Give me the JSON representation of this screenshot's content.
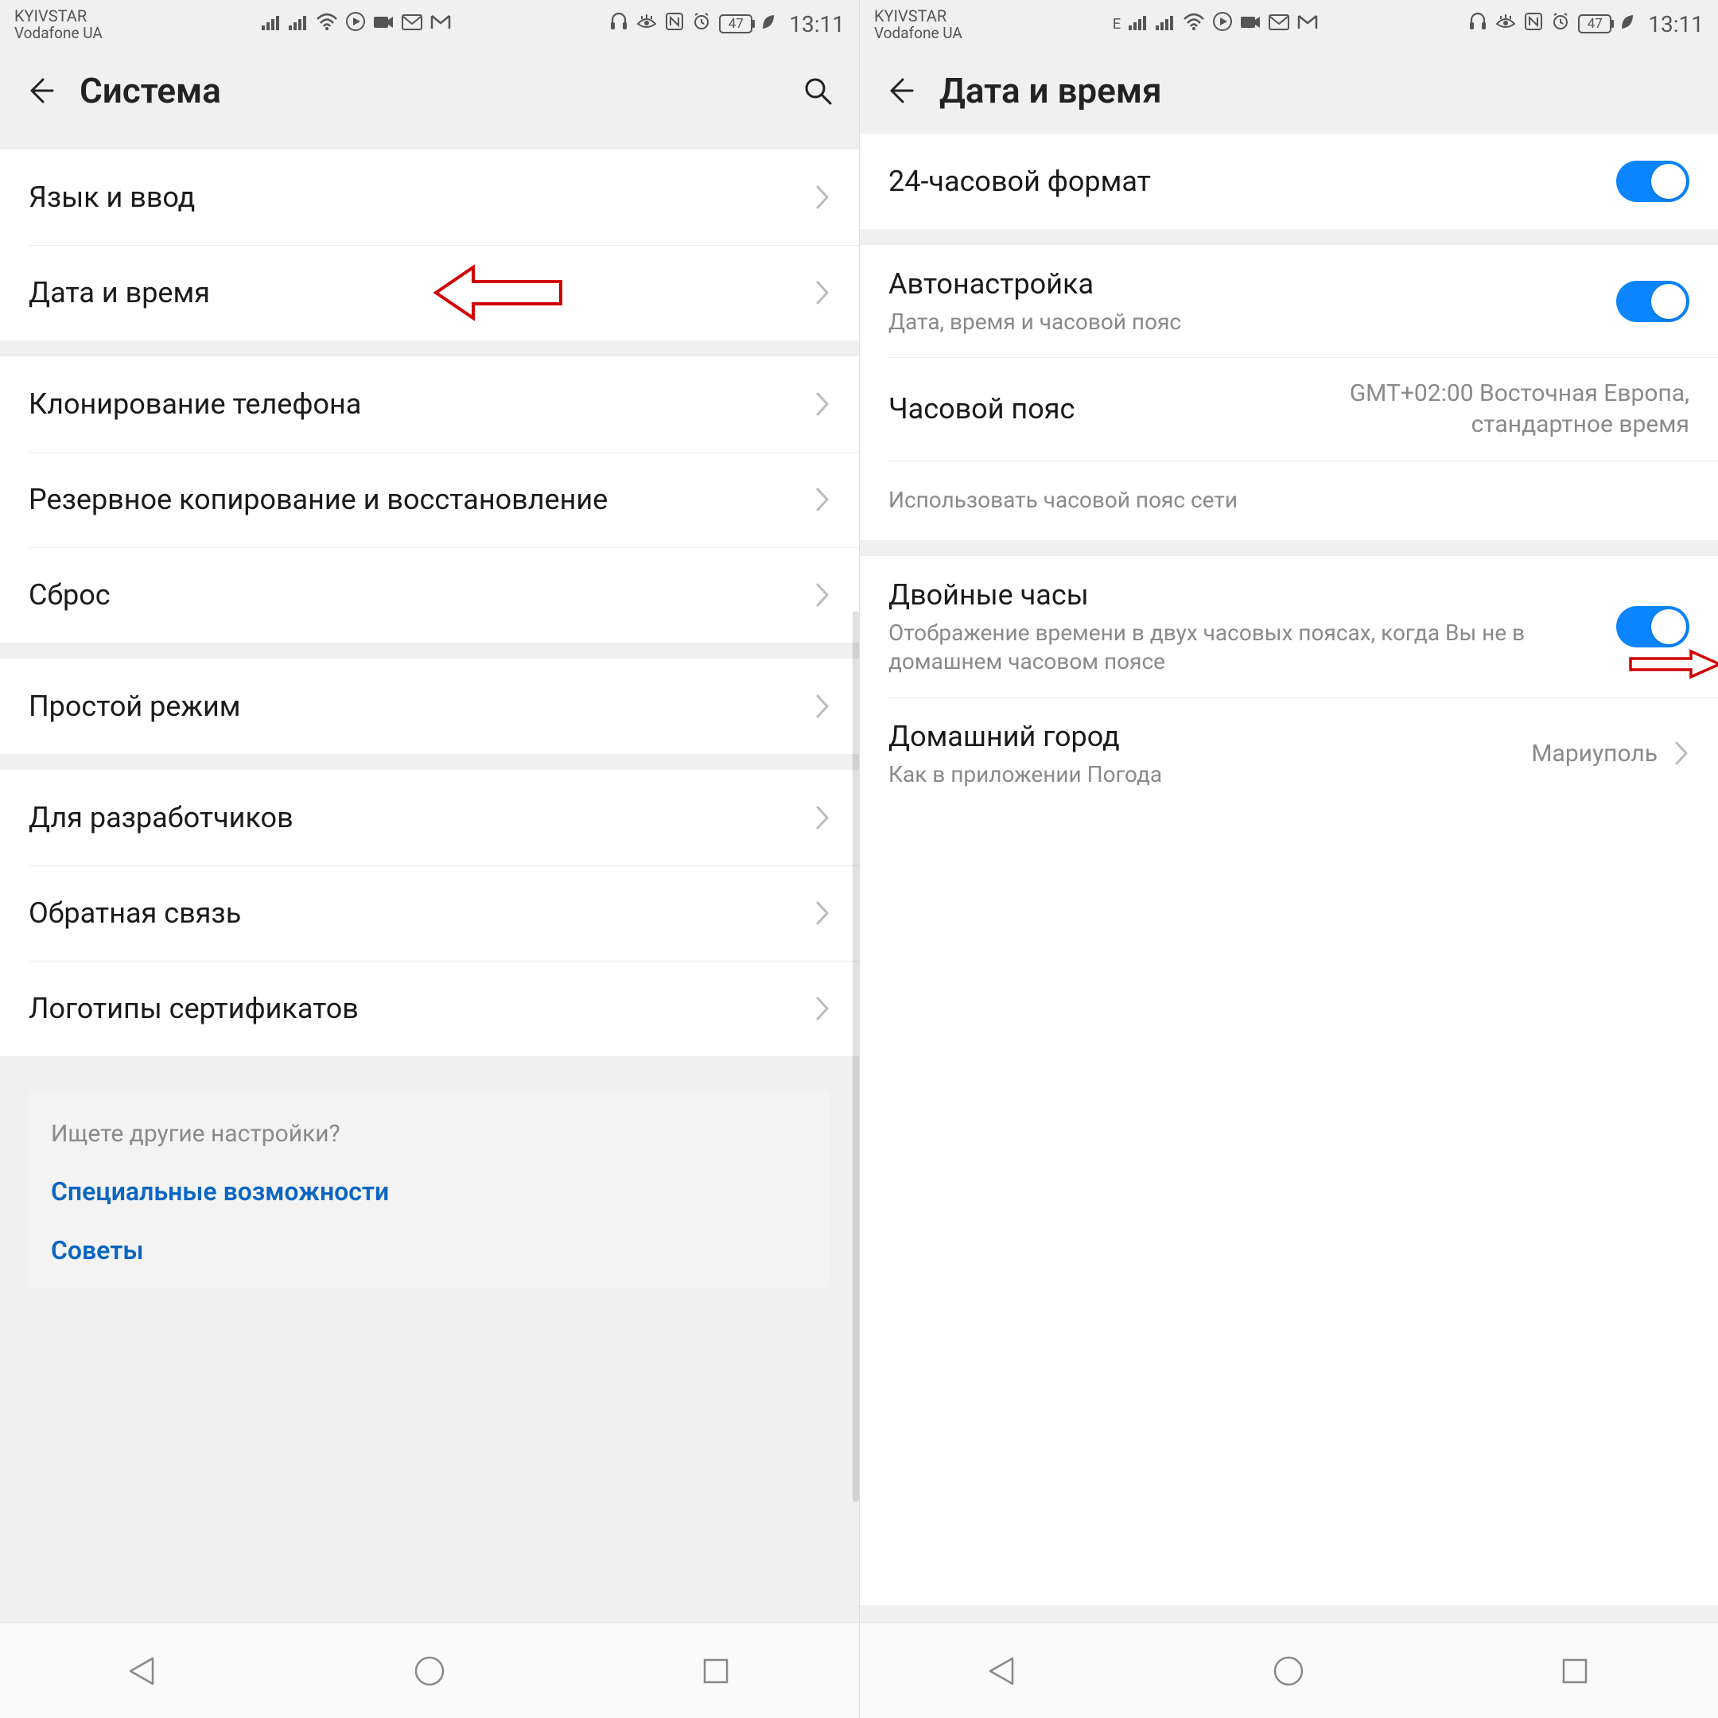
{
  "status": {
    "carrier1": "KYIVSTAR",
    "carrier2": "Vodafone UA",
    "extra_e": "E",
    "battery": "47",
    "time": "13:11"
  },
  "left": {
    "title": "Система",
    "groups": [
      {
        "items": [
          {
            "label": "Язык и ввод"
          },
          {
            "label": "Дата и время",
            "highlight_arrow": true
          }
        ]
      },
      {
        "items": [
          {
            "label": "Клонирование телефона"
          },
          {
            "label": "Резервное копирование и восстановление"
          },
          {
            "label": "Сброс"
          }
        ]
      },
      {
        "items": [
          {
            "label": "Простой режим"
          }
        ]
      },
      {
        "items": [
          {
            "label": "Для разработчиков"
          },
          {
            "label": "Обратная связь"
          },
          {
            "label": "Логотипы сертификатов"
          }
        ]
      }
    ],
    "footer": {
      "question": "Ищете другие настройки?",
      "links": [
        "Специальные возможности",
        "Советы"
      ]
    }
  },
  "right": {
    "title": "Дата и время",
    "groups": [
      {
        "items": [
          {
            "label": "24-часовой формат",
            "toggle": true
          }
        ]
      },
      {
        "items": [
          {
            "label": "Автонастройка",
            "sub": "Дата, время и часовой пояс",
            "toggle": true
          },
          {
            "label": "Часовой пояс",
            "value": "GMT+02:00 Восточная Европа, стандартное время",
            "no_chevron": true
          },
          {
            "label_only_sub": "Использовать часовой пояс сети",
            "disabled": true
          }
        ]
      },
      {
        "items": [
          {
            "label": "Двойные часы",
            "sub": "Отображение времени в двух часовых поясах, когда Вы не в домашнем часовом поясе",
            "toggle": true,
            "highlight_arrow_right": true
          },
          {
            "label": "Домашний город",
            "sub": "Как в приложении Погода",
            "value": "Мариуполь",
            "chevron": true
          }
        ]
      }
    ]
  }
}
